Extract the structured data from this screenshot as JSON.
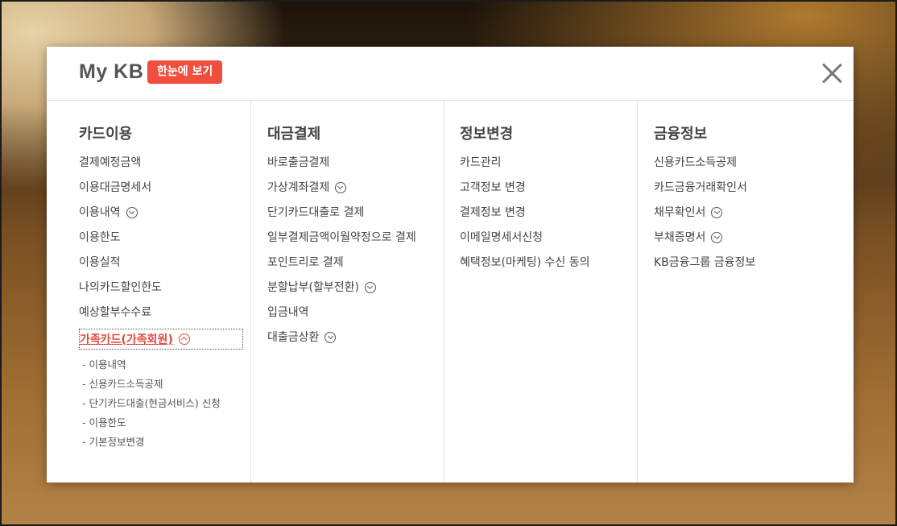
{
  "header": {
    "title": "My KB",
    "badge": "한눈에 보기"
  },
  "columns": [
    {
      "title": "카드이용",
      "items": [
        {
          "label": "결제예정금액",
          "chevron": false
        },
        {
          "label": "이용대금명세서",
          "chevron": false
        },
        {
          "label": "이용내역",
          "chevron": true
        },
        {
          "label": "이용한도",
          "chevron": false
        },
        {
          "label": "이용실적",
          "chevron": false
        },
        {
          "label": "나의카드할인한도",
          "chevron": false
        },
        {
          "label": "예상할부수수료",
          "chevron": false
        }
      ],
      "active": {
        "label": "가족카드(가족회원)",
        "subitems": [
          "이용내역",
          "신용카드소득공제",
          "단기카드대출(현금서비스) 신청",
          "이용한도",
          "기본정보변경"
        ]
      }
    },
    {
      "title": "대금결제",
      "items": [
        {
          "label": "바로출금결제",
          "chevron": false
        },
        {
          "label": "가상계좌결제",
          "chevron": true
        },
        {
          "label": "단기카드대출로 결제",
          "chevron": false
        },
        {
          "label": "일부결제금액이월약정으로 결제",
          "chevron": false
        },
        {
          "label": "포인트리로 결제",
          "chevron": false
        },
        {
          "label": "분할납부(할부전환)",
          "chevron": true
        },
        {
          "label": "입금내역",
          "chevron": false
        },
        {
          "label": "대출금상환",
          "chevron": true
        }
      ]
    },
    {
      "title": "정보변경",
      "items": [
        {
          "label": "카드관리",
          "chevron": false
        },
        {
          "label": "고객정보 변경",
          "chevron": false
        },
        {
          "label": "결제정보 변경",
          "chevron": false
        },
        {
          "label": "이메일명세서신청",
          "chevron": false
        },
        {
          "label": "혜택정보(마케팅) 수신 동의",
          "chevron": false
        }
      ]
    },
    {
      "title": "금융정보",
      "items": [
        {
          "label": "신용카드소득공제",
          "chevron": false
        },
        {
          "label": "카드금융거래확인서",
          "chevron": false
        },
        {
          "label": "채무확인서",
          "chevron": true
        },
        {
          "label": "부채증명서",
          "chevron": true
        },
        {
          "label": "KB금융그룹 금융정보",
          "chevron": false
        }
      ]
    }
  ],
  "colors": {
    "accent": "#f04e3e",
    "active_text": "#e04a3a"
  }
}
